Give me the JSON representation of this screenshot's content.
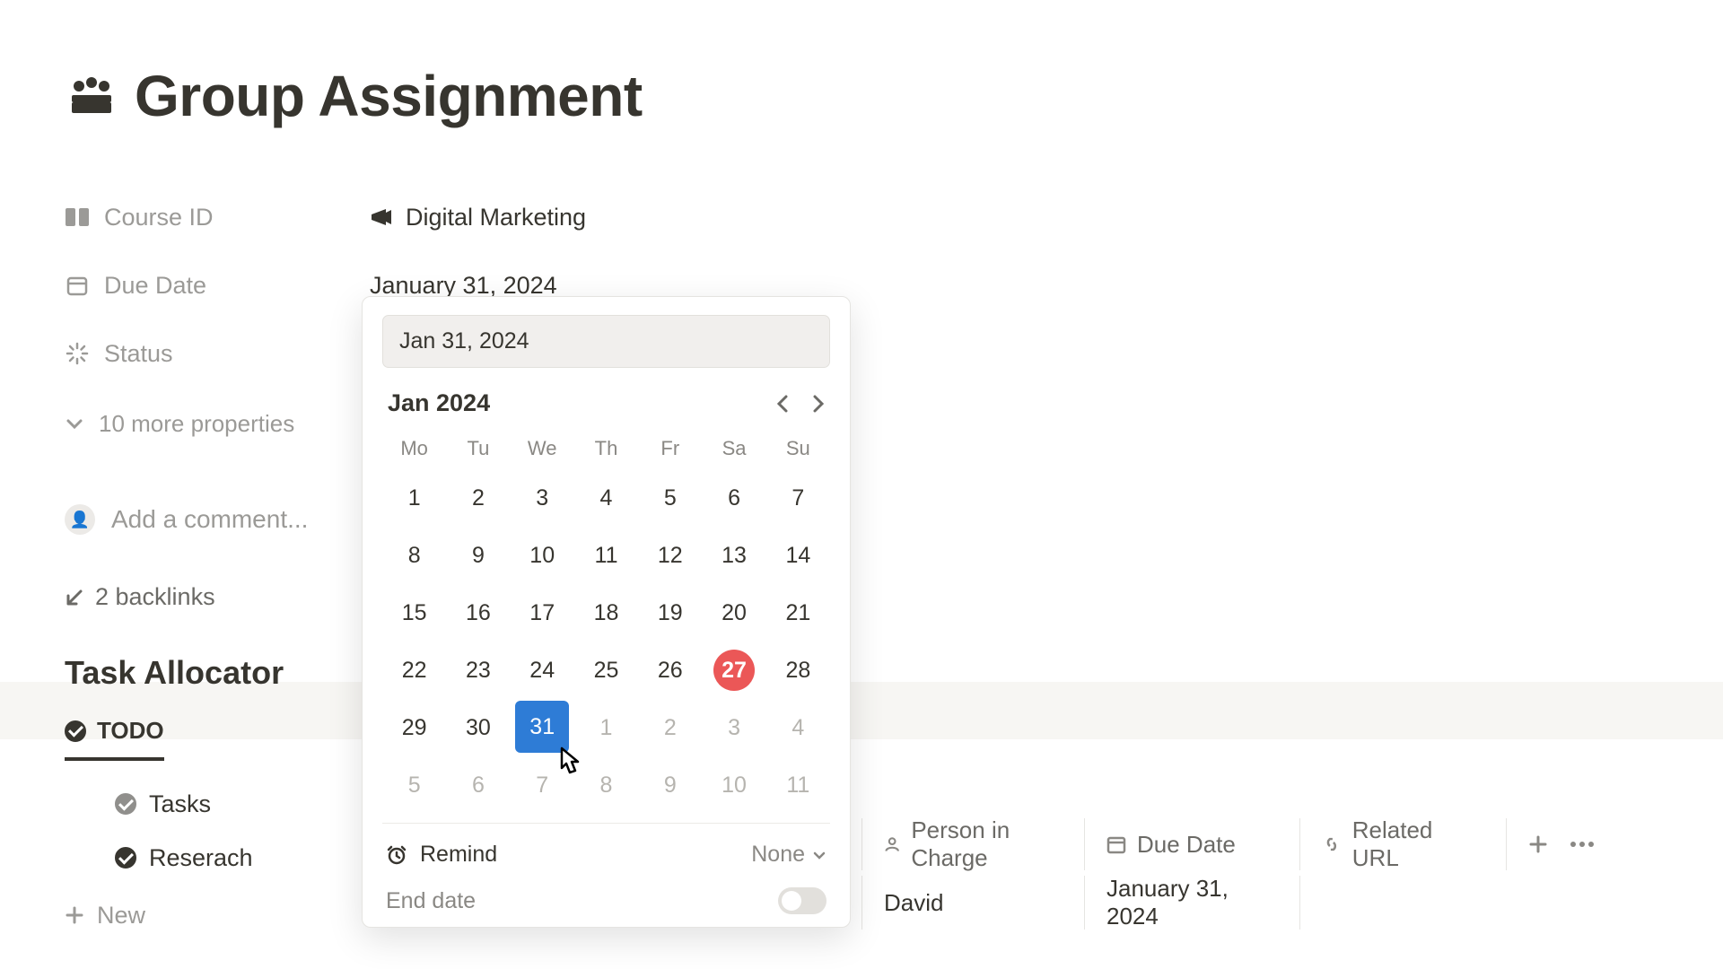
{
  "title": "Group Assignment",
  "properties": {
    "course_label": "Course ID",
    "course_value": "Digital Marketing",
    "due_label": "Due Date",
    "due_value": "January 31, 2024",
    "status_label": "Status",
    "more_label": "10 more properties"
  },
  "comment_placeholder": "Add a comment...",
  "backlinks_label": "2 backlinks",
  "section": {
    "title": "Task Allocator",
    "tab_todo": "TODO",
    "child_tasks": "Tasks",
    "child_research": "Reserach",
    "new_label": "New"
  },
  "db": {
    "col_person": "Person in Charge",
    "col_due": "Due Date",
    "col_url": "Related URL",
    "row_person": "David",
    "row_due": "January 31, 2024"
  },
  "datepicker": {
    "input_value": "Jan 31, 2024",
    "month_label": "Jan 2024",
    "weekdays": [
      "Mo",
      "Tu",
      "We",
      "Th",
      "Fr",
      "Sa",
      "Su"
    ],
    "remind_label": "Remind",
    "remind_value": "None",
    "end_label": "End date",
    "today": 27,
    "selected": 31
  }
}
